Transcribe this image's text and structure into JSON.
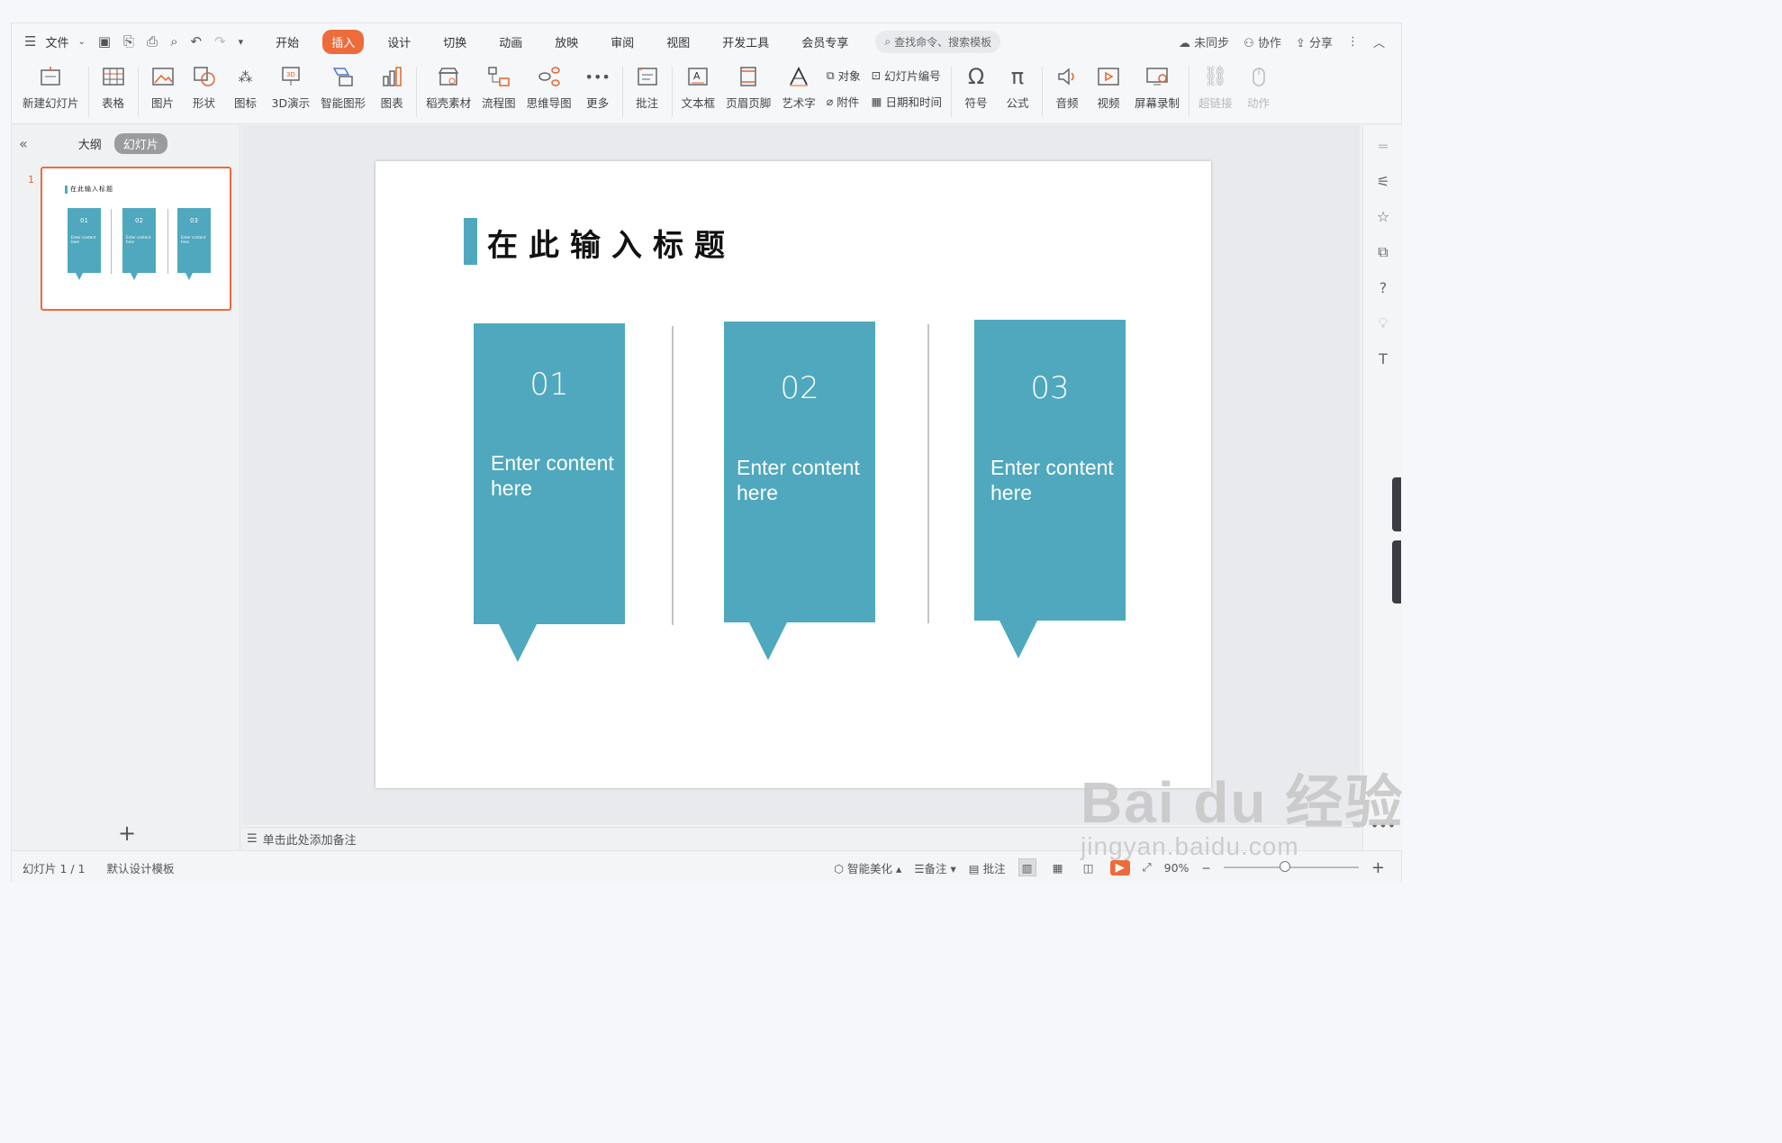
{
  "menubar": {
    "file": "文件",
    "tabs": [
      "开始",
      "插入",
      "设计",
      "切换",
      "动画",
      "放映",
      "审阅",
      "视图",
      "开发工具",
      "会员专享"
    ],
    "active_tab": "插入",
    "search_placeholder": "查找命令、搜索模板",
    "sync": "未同步",
    "collab": "协作",
    "share": "分享"
  },
  "ribbon": {
    "new_slide": "新建幻灯片",
    "table": "表格",
    "image": "图片",
    "shape": "形状",
    "icon": "图标",
    "3d": "3D演示",
    "smartart": "智能图形",
    "chart": "图表",
    "material": "稻壳素材",
    "flowchart": "流程图",
    "mindmap": "思维导图",
    "more": "更多",
    "comment": "批注",
    "textbox": "文本框",
    "header_footer": "页眉页脚",
    "wordart": "艺术字",
    "object": "对象",
    "slide_number": "幻灯片编号",
    "attachment": "附件",
    "datetime": "日期和时间",
    "symbol": "符号",
    "formula": "公式",
    "audio": "音频",
    "video": "视频",
    "screen_record": "屏幕录制",
    "hyperlink": "超链接",
    "action": "动作"
  },
  "leftpanel": {
    "outline": "大纲",
    "slides": "幻灯片",
    "slide_number": "1"
  },
  "slide": {
    "title": "在此输入标题",
    "cards": [
      {
        "num": "01",
        "text": "Enter content here"
      },
      {
        "num": "02",
        "text": "Enter content here"
      },
      {
        "num": "03",
        "text": "Enter content here"
      }
    ],
    "accent": "#4fa8be"
  },
  "notes": {
    "placeholder": "单击此处添加备注"
  },
  "status": {
    "slide_count": "幻灯片 1 / 1",
    "template": "默认设计模板",
    "beautify": "智能美化",
    "notes": "备注",
    "comment": "批注",
    "zoom": "90%"
  },
  "watermark": {
    "brand": "Bai du 经验",
    "url": "jingyan.baidu.com"
  }
}
